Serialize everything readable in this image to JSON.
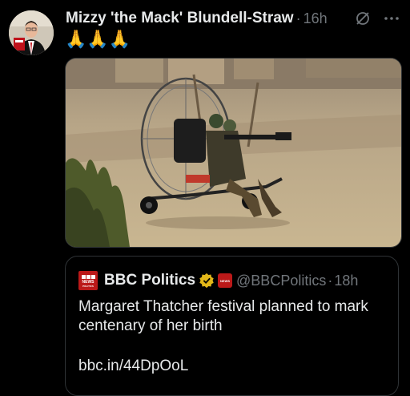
{
  "tweet": {
    "display_name": "Mizzy 'the Mack' Blundell-Straw",
    "separator": "·",
    "time": "16h",
    "text": "🙏🙏🙏",
    "avatar_icon": "avatar-photo",
    "grok_icon": "slashed-circle-icon",
    "more_icon": "more-dots-icon"
  },
  "media": {
    "icon": "video-still-paramotor"
  },
  "quote": {
    "display_name": "BBC Politics",
    "handle": "@BBCPolitics",
    "separator": "·",
    "time": "18h",
    "body": "Margaret Thatcher festival planned to mark centenary of her birth",
    "link": "bbc.in/44DpOoL",
    "logo_text_1": "NEWS",
    "logo_text_2": "POLITICS",
    "affil_text": "NEWS"
  },
  "colors": {
    "background": "#000000",
    "text": "#e7e9ea",
    "muted": "#71767b",
    "bbc_red": "#bb1919",
    "verified_gold": "#e2b719"
  }
}
